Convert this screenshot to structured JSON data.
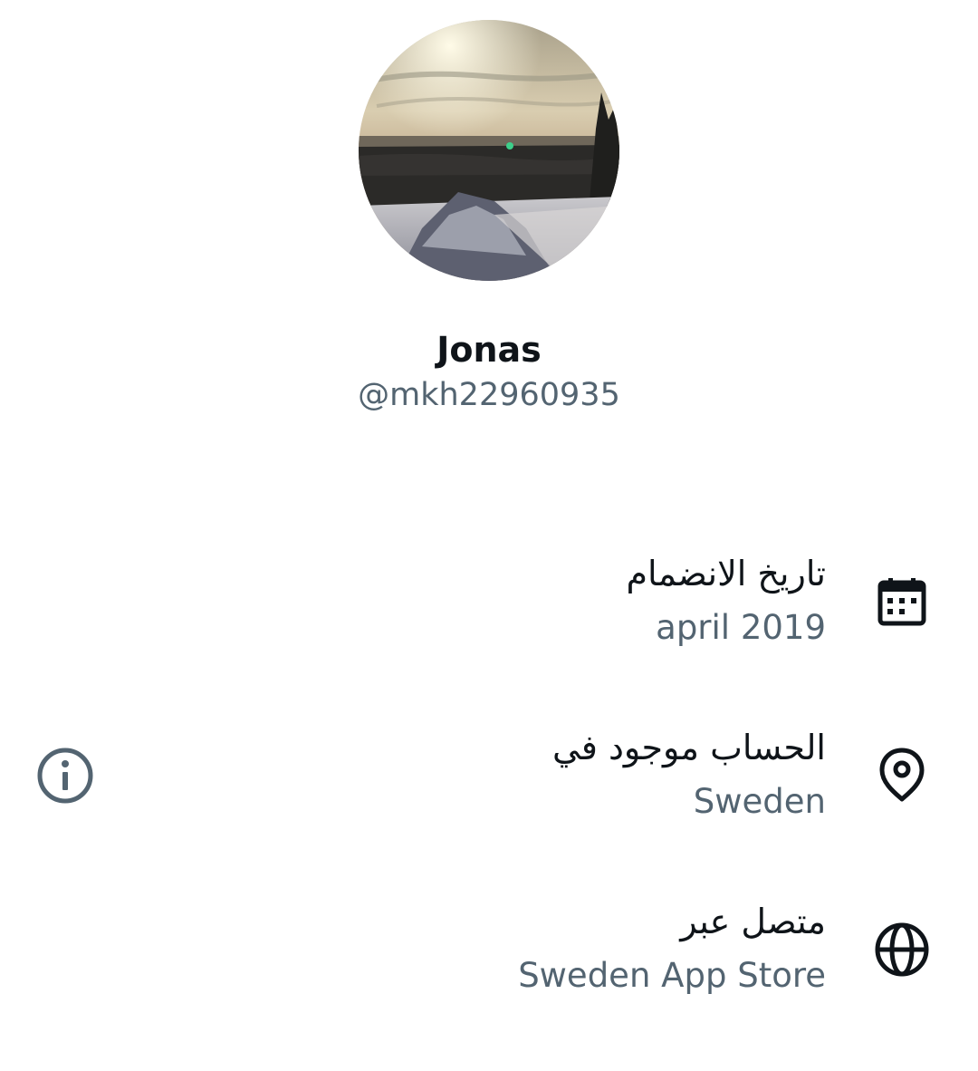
{
  "profile": {
    "display_name": "Jonas",
    "handle": "@mkh22960935",
    "avatar_icon": "profile-photo-snowy-sunset"
  },
  "about": {
    "rows": [
      {
        "label": "تاريخ الانضمام",
        "value": "april 2019",
        "icon": "calendar-icon"
      },
      {
        "label": "الحساب موجود في",
        "value": "Sweden",
        "icon": "location-pin-icon"
      },
      {
        "label": "متصل عبر",
        "value": "Sweden App Store",
        "icon": "globe-icon"
      }
    ],
    "info_icon": "info-icon"
  },
  "colors": {
    "primary_text": "#0f1419",
    "secondary_text": "#536471",
    "background": "#ffffff"
  }
}
